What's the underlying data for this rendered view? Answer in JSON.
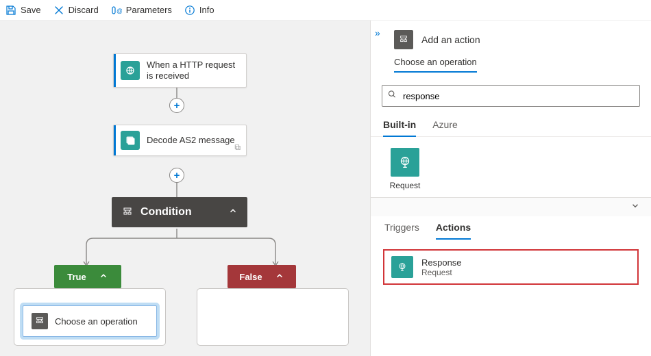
{
  "toolbar": {
    "save": "Save",
    "discard": "Discard",
    "parameters": "Parameters",
    "info": "Info"
  },
  "workflow": {
    "trigger_title": "When a HTTP request is received",
    "action1_title": "Decode AS2 message",
    "condition_title": "Condition",
    "true_label": "True",
    "false_label": "False",
    "choose_op": "Choose an operation"
  },
  "panel": {
    "header": "Add an action",
    "subheader": "Choose an operation",
    "search_value": "response",
    "scope_tabs": {
      "builtin": "Built-in",
      "azure": "Azure"
    },
    "connector": {
      "request": "Request"
    },
    "ta_tabs": {
      "triggers": "Triggers",
      "actions": "Actions"
    },
    "result": {
      "title": "Response",
      "subtitle": "Request"
    }
  }
}
